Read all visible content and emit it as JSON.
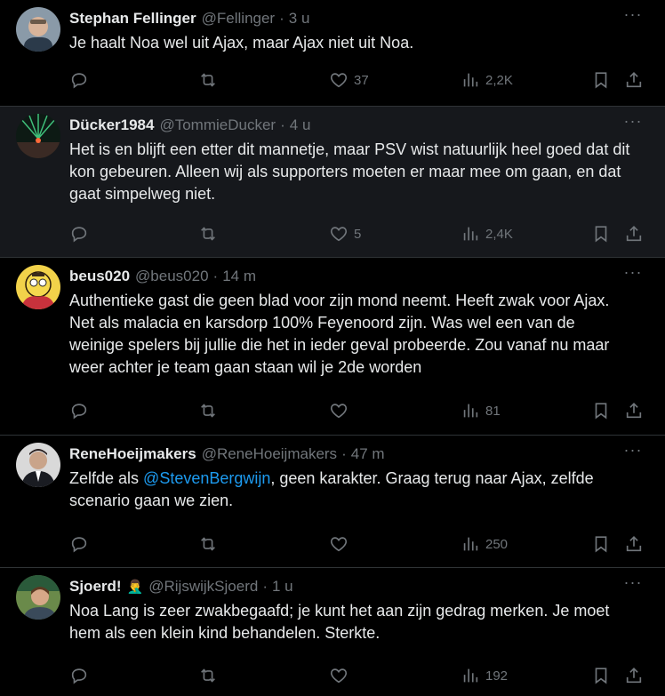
{
  "tweets": [
    {
      "name": "Stephan Fellinger",
      "emoji": "",
      "handle": "@Fellinger",
      "time": "3 u",
      "text": [
        {
          "t": "Je haalt Noa wel uit Ajax, maar Ajax niet uit Noa.",
          "mention": false
        }
      ],
      "likes": "37",
      "views": "2,2K"
    },
    {
      "name": "Dücker1984",
      "emoji": "",
      "handle": "@TommieDucker",
      "time": "4 u",
      "text": [
        {
          "t": "Het is en blijft een etter dit mannetje, maar PSV wist natuurlijk heel goed dat dit kon gebeuren. Alleen wij als supporters moeten er maar mee om gaan, en dat gaat simpelweg niet.",
          "mention": false
        }
      ],
      "likes": "5",
      "views": "2,4K"
    },
    {
      "name": "beus020",
      "emoji": "",
      "handle": "@beus020",
      "time": "14 m",
      "text": [
        {
          "t": "Authentieke gast die geen blad voor zijn mond neemt. Heeft zwak voor Ajax. Net als malacia en karsdorp 100% Feyenoord zijn. Was wel een van de weinige spelers bij jullie die het in ieder geval probeerde. Zou vanaf nu maar weer achter je team gaan staan wil je 2de worden",
          "mention": false
        }
      ],
      "likes": "",
      "views": "81"
    },
    {
      "name": "ReneHoeijmakers",
      "emoji": "",
      "handle": "@ReneHoeijmakers",
      "time": "47 m",
      "text": [
        {
          "t": "Zelfde als ",
          "mention": false
        },
        {
          "t": "@StevenBergwijn",
          "mention": true
        },
        {
          "t": ", geen karakter. Graag terug naar Ajax, zelfde scenario gaan we zien.",
          "mention": false
        }
      ],
      "likes": "",
      "views": "250"
    },
    {
      "name": "Sjoerd!",
      "emoji": "🤦‍♂️",
      "handle": "@RijswijkSjoerd",
      "time": "1 u",
      "text": [
        {
          "t": "Noa Lang is zeer zwakbegaafd; je kunt het aan zijn gedrag merken. Je moet hem als een klein kind behandelen. Sterkte.",
          "mention": false
        }
      ],
      "likes": "",
      "views": "192"
    }
  ],
  "ui": {
    "dot": "·",
    "more": "···"
  },
  "colors": {
    "background": "#000000",
    "hover_background": "#16181c",
    "text": "#e7e9ea",
    "secondary": "#71767b",
    "link": "#1d9bf0",
    "divider": "#2f3336"
  }
}
